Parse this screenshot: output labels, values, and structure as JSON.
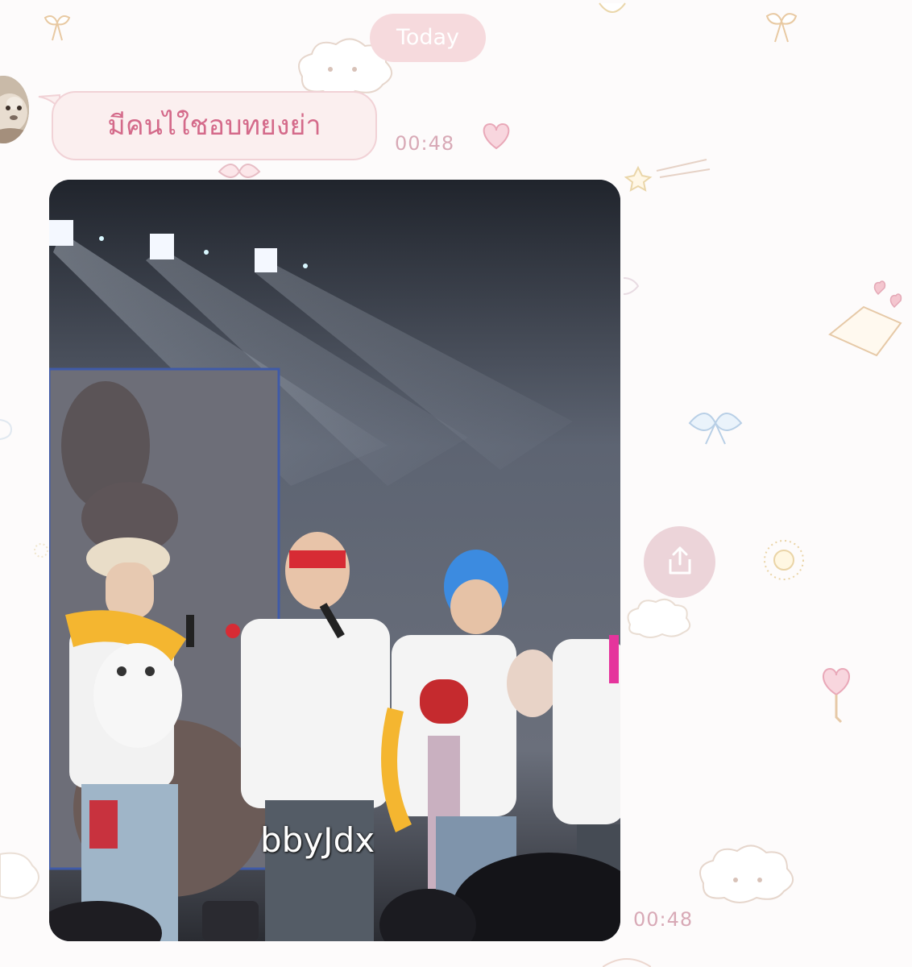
{
  "chat": {
    "date_label": "Today",
    "messages": [
      {
        "type": "text",
        "text": "มีคนไใชอบทยงย่า",
        "time": "00:48"
      },
      {
        "type": "image",
        "watermark": "bbyJdx",
        "time": "00:48"
      }
    ]
  },
  "icons": {
    "share": "share-icon",
    "avatar": "avatar-image"
  },
  "colors": {
    "bubble_bg": "#fbefef",
    "bubble_text": "#d46a8a",
    "time_text": "#d8a9b6",
    "date_chip": "#f6dadd",
    "share_button": "#ecd4d9"
  }
}
